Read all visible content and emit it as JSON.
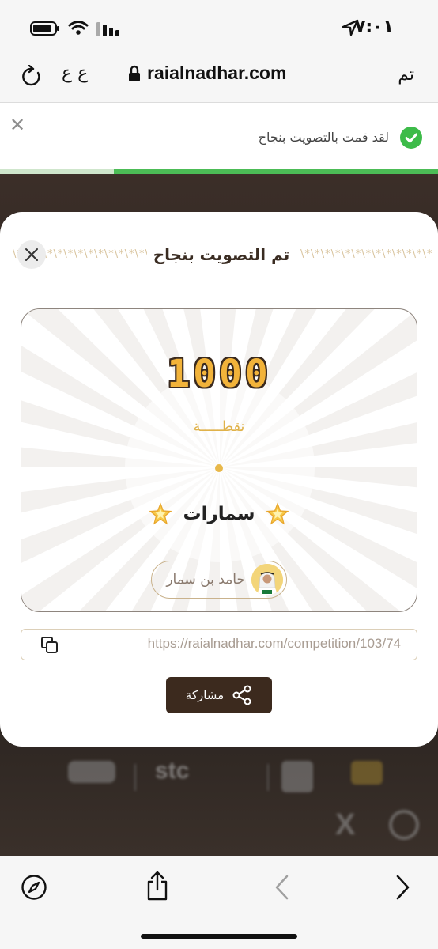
{
  "status_bar": {
    "time": "٧:٠١"
  },
  "address_bar": {
    "reader_label": "ع ع",
    "url": "raialnadhar.com",
    "done_label": "تم"
  },
  "notification": {
    "message": "لقد قمت بالتصويت بنجاح",
    "progress": 0.74
  },
  "modal": {
    "title": "تم التصويت بنجاح",
    "deco_left": "\\*\\*\\*\\*\\*\\*\\*\\*\\*\\*\\*\\*\\*\\*",
    "deco_right": "\\*\\*\\*\\*\\*\\*\\*\\*\\*\\*\\*\\*\\*\\*",
    "points": "1000",
    "points_label": "نقطـــــة",
    "team_name": "سمارات",
    "voter_name": "حامد بن سمار",
    "link": "https://raialnadhar.com/competition/103/74",
    "share_label": "مشاركة"
  },
  "background": {
    "sponsor_text": "stc",
    "x_text": "X"
  },
  "colors": {
    "accent_gold": "#f2b33a",
    "brand_dark": "#3c2a1e",
    "success_green": "#3dbb49"
  },
  "icons": [
    "location-arrow-icon",
    "wifi-icon",
    "signal-icon",
    "battery-icon",
    "reload-icon",
    "lock-icon",
    "close-icon",
    "check-icon",
    "star-icon",
    "copy-icon",
    "share-icon",
    "compass-icon",
    "share-sheet-icon",
    "back-icon",
    "forward-icon"
  ]
}
